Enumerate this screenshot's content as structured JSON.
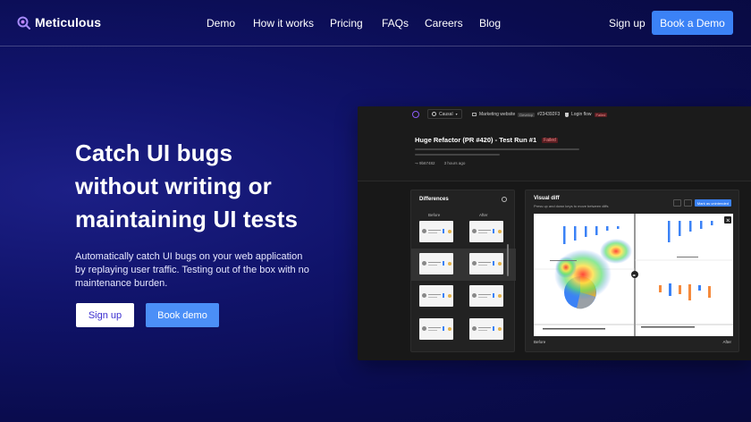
{
  "nav": {
    "brand": "Meticulous",
    "links": [
      "Demo",
      "How it works",
      "Pricing",
      "FAQs",
      "Careers",
      "Blog"
    ],
    "signup": "Sign up",
    "cta": "Book a Demo"
  },
  "hero": {
    "title_lines": [
      "Catch UI bugs",
      "without writing or",
      "maintaining UI tests"
    ],
    "subtitle": "Automatically catch UI bugs on your web application by replaying user traffic. Testing out of the box with no maintenance burden.",
    "signup_button": "Sign up",
    "demo_button": "Book demo"
  },
  "app": {
    "project": "Causal",
    "crumb_site": "Marketing website",
    "crumb_site_tag": "Develop",
    "crumb_id": "#234392F3",
    "crumb_flow": "Login flow",
    "crumb_flow_tag": "Failed",
    "run_title": "Huge Refactor (PR #420) - Test Run #1",
    "run_status": "Failed",
    "commit": "9b67482",
    "time_ago": "3 hours ago",
    "differences": {
      "title": "Differences",
      "before": "Before",
      "after": "After"
    },
    "visual_diff": {
      "title": "Visual diff",
      "hint": "Press up and down keys to move between diffs",
      "mark_button": "Mark as unintended",
      "before": "Before",
      "after": "After"
    }
  },
  "colors": {
    "accent": "#3b82f6",
    "brand_purple": "#8b5cf6",
    "failed_tag": "#f58c8c"
  }
}
